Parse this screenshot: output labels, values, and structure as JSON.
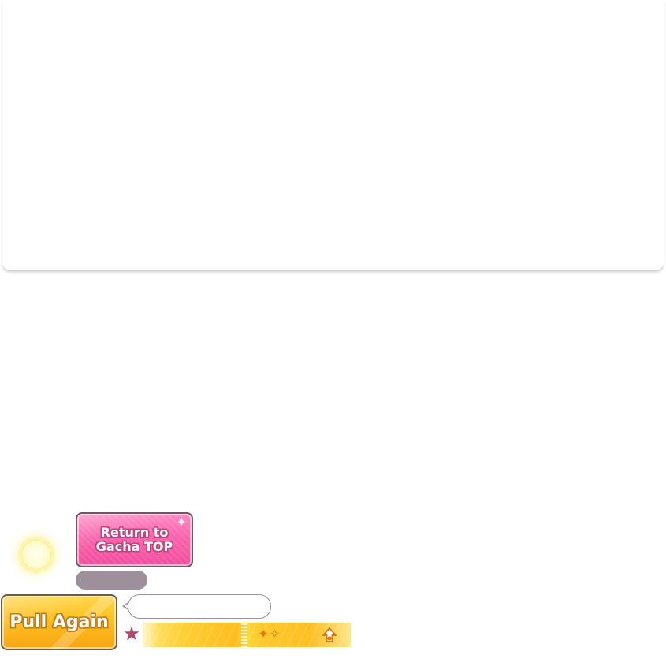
{
  "buttons": {
    "return_line1": "Return to",
    "return_line2": "Gacha TOP",
    "pull_again": "Pull Again"
  },
  "speech_bubble": {
    "text": ""
  },
  "gray_pill": {
    "text": ""
  },
  "icons": {
    "orb": "glow-orb",
    "star": "star-icon",
    "sparkle": "sparkle-icon",
    "up_arrow": "up-arrow-icon",
    "return_sparkle": "sparkle-icon"
  },
  "colors": {
    "return_button": "#f864ad",
    "pull_button": "#ffbe1e",
    "gray_pill": "#9e8f9c",
    "star": "#b0476f",
    "bonus_strip": "#ffc72a"
  }
}
